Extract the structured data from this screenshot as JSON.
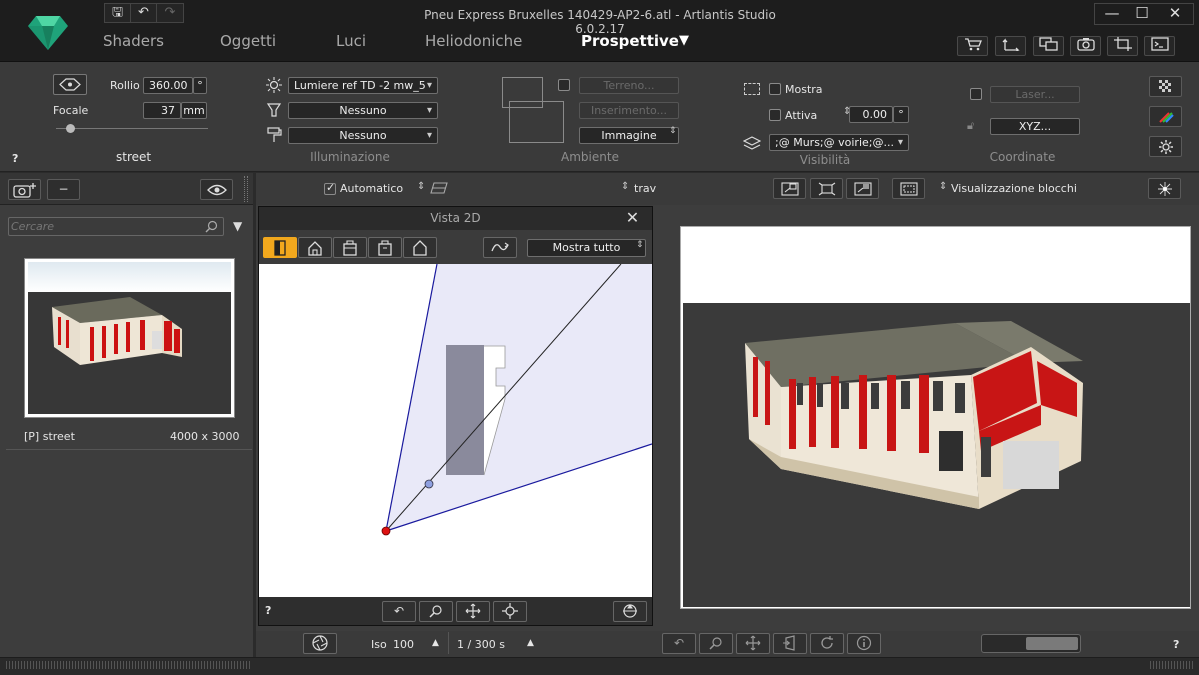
{
  "app": {
    "title": "Pneu Express Bruxelles 140429-AP2-6.atl - Artlantis Studio 6.0.2.17"
  },
  "quick_access": {
    "save": "🖫",
    "undo": "↶",
    "redo": "↷"
  },
  "window_controls": {
    "minimize": "—",
    "maximize": "☐",
    "close": "✕"
  },
  "tabs": [
    {
      "label": "Shaders"
    },
    {
      "label": "Oggetti"
    },
    {
      "label": "Luci"
    },
    {
      "label": "Heliodoniche"
    },
    {
      "label": "Prospettive"
    }
  ],
  "tabs_dropdown": "▼",
  "camera": {
    "rollio_label": "Rollio",
    "rollio_value": "360.00",
    "rollio_unit": "°",
    "focale_label": "Focale",
    "focale_value": "37",
    "focale_unit": "mm",
    "view_name": "street",
    "help": "?"
  },
  "illumination": {
    "light_value": "Lumiere ref TD -2 mw_5",
    "lamp_value": "Nessuno",
    "paint_value": "Nessuno",
    "group_label": "Illuminazione"
  },
  "environment": {
    "terrain": "Terreno...",
    "insert": "Inserimento...",
    "background": "Immagine",
    "group_label": "Ambiente"
  },
  "visibility": {
    "show_label": "Mostra",
    "active_label": "Attiva",
    "active_value": "0.00",
    "active_unit": "°",
    "layers_value": ";@ Murs;@ voirie;@...",
    "group_label": "Visibilità"
  },
  "coords": {
    "laser": "Laser...",
    "xyz": "XYZ...",
    "group_label": "Coordinate"
  },
  "left_panel": {
    "search_placeholder": "Cercare",
    "view_tag": "[P] street",
    "resolution": "4000 x 3000"
  },
  "center_toolbar": {
    "auto_label": "Automatico",
    "trav_label": "trav",
    "blocks_label": "Visualizzazione blocchi"
  },
  "view2d": {
    "title": "Vista 2D",
    "show_all": "Mostra tutto",
    "help": "?",
    "close": "✕"
  },
  "bottom": {
    "iso_label": "Iso",
    "iso_value": "100",
    "shutter_value": "1 / 300 s",
    "help": "?"
  },
  "colors": {
    "accent": "#f2a81d",
    "camera_point": "#d11",
    "cone_fill": "#e6e6f7",
    "cone_line": "#1a1a9e",
    "building": "#8a8a9c"
  }
}
